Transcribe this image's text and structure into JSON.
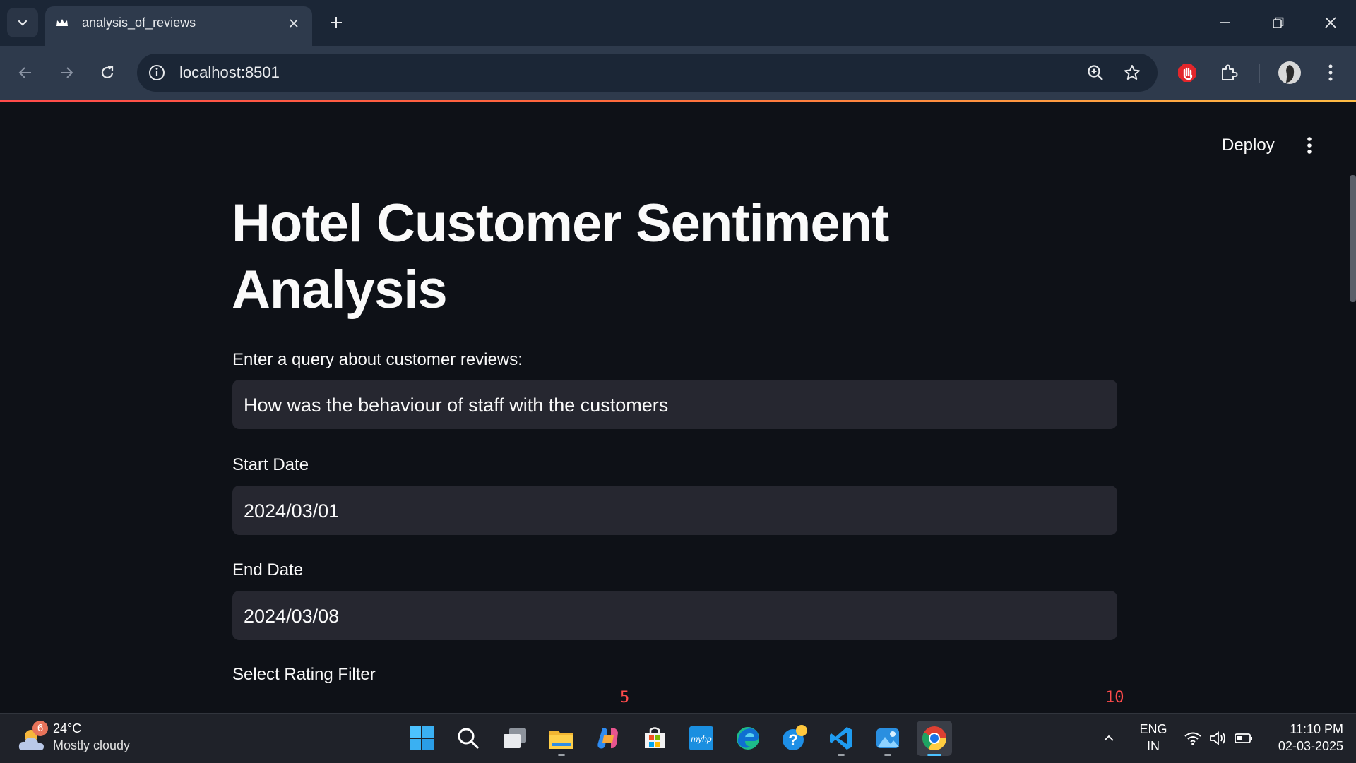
{
  "browser": {
    "tab_title": "analysis_of_reviews",
    "url": "localhost:8501"
  },
  "app": {
    "deploy_label": "Deploy",
    "title": "Hotel Customer Sentiment Analysis",
    "query": {
      "label": "Enter a query about customer reviews:",
      "value": "How was the behaviour of staff with the customers"
    },
    "start_date": {
      "label": "Start Date",
      "value": "2024/03/01"
    },
    "end_date": {
      "label": "End Date",
      "value": "2024/03/08"
    },
    "rating_filter": {
      "label": "Select Rating Filter",
      "tick_low": "5",
      "tick_high": "10"
    }
  },
  "taskbar": {
    "weather": {
      "badge": "6",
      "temp": "24°C",
      "condition": "Mostly cloudy"
    },
    "apps": [
      "start-icon",
      "search-icon",
      "task-view-icon",
      "file-explorer-icon",
      "copilot-icon",
      "microsoft-store-icon",
      "myhp-icon",
      "edge-icon",
      "get-help-icon",
      "vscode-icon",
      "photos-icon",
      "chrome-icon"
    ],
    "language": {
      "line1": "ENG",
      "line2": "IN"
    },
    "clock": {
      "time": "11:10 PM",
      "date": "02-03-2025"
    }
  },
  "colors": {
    "accent": "#ff4b4b",
    "background": "#0e1117",
    "input_bg": "#262730"
  }
}
